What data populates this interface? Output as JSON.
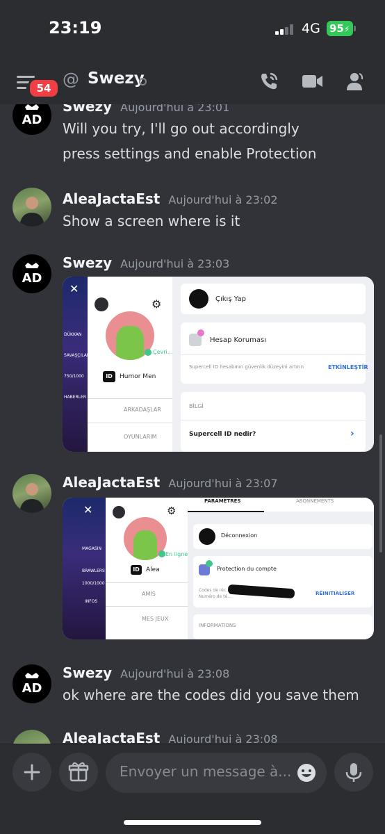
{
  "status_bar": {
    "time": "23:19",
    "network": "4G",
    "battery": "95"
  },
  "header": {
    "unread_badge": "54",
    "at_symbol": "@",
    "channel_name": "Swezy",
    "icons": [
      "menu-icon",
      "call-icon",
      "video-icon",
      "members-icon"
    ]
  },
  "messages": [
    {
      "author": "Swezy",
      "timestamp": "Aujourd'hui à 23:01",
      "lines": [
        "Will you try, I'll go out accordingly",
        "press settings and enable Protection"
      ]
    },
    {
      "author": "AleaJactaEst",
      "timestamp": "Aujourd'hui à 23:02",
      "lines": [
        "Show a screen where is it"
      ]
    },
    {
      "author": "Swezy",
      "timestamp": "Aujourd'hui à 23:03",
      "attachment": {
        "left_game_labels": [
          "DÜKKAN",
          "SAVAŞÇILAR",
          "750/1000",
          "HABERLER"
        ],
        "profile_status": "Çevri...",
        "id_label": "ID",
        "profile_name": "Humor Men",
        "menu_friends": "ARKADAŞLAR",
        "menu_games": "OYUNLARIM",
        "logout": "Çıkış Yap",
        "protection_title": "Hesap Koruması",
        "protection_desc": "Supercell ID hesabının güvenlik düzeyini artırın",
        "protection_action": "ETKİNLEŞTİR",
        "info_header": "BİLGİ",
        "info_item": "Supercell ID nedir?",
        "info_chevron": "›"
      }
    },
    {
      "author": "AleaJactaEst",
      "timestamp": "Aujourd'hui à 23:07",
      "attachment": {
        "left_game_labels": [
          "MAGASIN",
          "BRAWLERS",
          "1000/1000",
          "INFOS"
        ],
        "tabs": [
          "PARAMÈTRES",
          "ABONNEMENTS"
        ],
        "profile_status": "En ligne",
        "id_label": "ID",
        "profile_name": "Alea",
        "menu_friends": "AMIS",
        "menu_games": "MES JEUX",
        "logout": "Déconnexion",
        "protection_title": "Protection du compte",
        "codes_line1": "Codes de réc...",
        "codes_line2": "Numéro de té...",
        "reset_action": "RÉINITIALISER",
        "info_header": "INFORMATIONS"
      }
    },
    {
      "author": "Swezy",
      "timestamp": "Aujourd'hui à 23:08",
      "lines": [
        "ok where are the codes did you save them"
      ]
    },
    {
      "author": "AleaJactaEst",
      "timestamp": "Aujourd'hui à 23:08"
    }
  ],
  "composer": {
    "placeholder": "Envoyer un message à...",
    "icons": [
      "plus-icon",
      "gift-icon",
      "emoji-icon",
      "microphone-icon"
    ]
  },
  "colors": {
    "background": "#313338",
    "bars": "#2b2d31",
    "badge": "#f23f43",
    "battery": "#34c759",
    "accent_blue": "#2d6ee6"
  }
}
